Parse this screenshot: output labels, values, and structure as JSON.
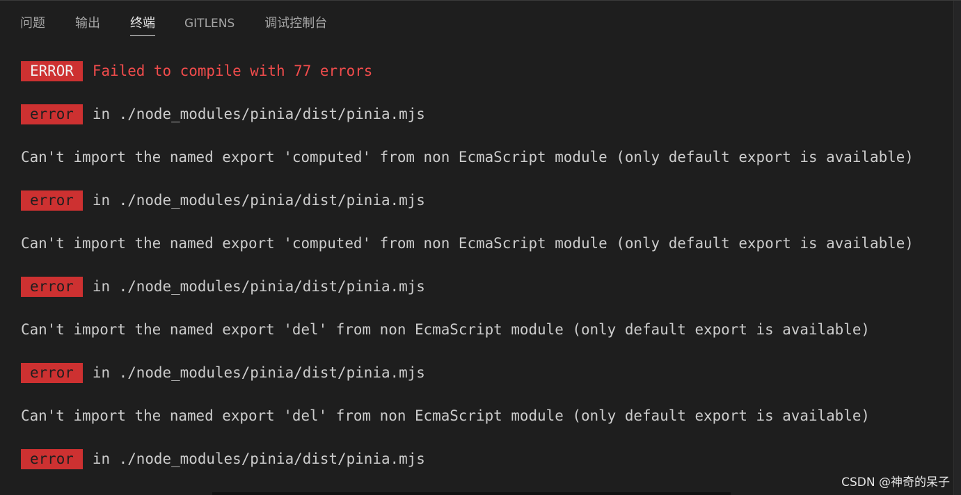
{
  "tabs": [
    {
      "label": "问题"
    },
    {
      "label": "输出"
    },
    {
      "label": "终端",
      "active": true
    },
    {
      "label": "GITLENS"
    },
    {
      "label": "调试控制台"
    }
  ],
  "terminal": {
    "header": {
      "badge": "ERROR",
      "message": "Failed to compile with 77 errors"
    },
    "lines": [
      {
        "badge": "error",
        "text": "in ./node_modules/pinia/dist/pinia.mjs"
      },
      {
        "text": "Can't import the named export 'computed' from non EcmaScript module (only default export is available)"
      },
      {
        "badge": "error",
        "text": "in ./node_modules/pinia/dist/pinia.mjs"
      },
      {
        "text": "Can't import the named export 'computed' from non EcmaScript module (only default export is available)"
      },
      {
        "badge": "error",
        "text": "in ./node_modules/pinia/dist/pinia.mjs"
      },
      {
        "text": "Can't import the named export 'del' from non EcmaScript module (only default export is available)"
      },
      {
        "badge": "error",
        "text": "in ./node_modules/pinia/dist/pinia.mjs"
      },
      {
        "text": "Can't import the named export 'del' from non EcmaScript module (only default export is available)"
      },
      {
        "badge": "error",
        "text": "in ./node_modules/pinia/dist/pinia.mjs"
      }
    ]
  },
  "watermark": "CSDN @神奇的呆子",
  "colors": {
    "background": "#1e1e1e",
    "error_red": "#cd3131",
    "error_text": "#f14c4c",
    "foreground": "#cccccc"
  }
}
